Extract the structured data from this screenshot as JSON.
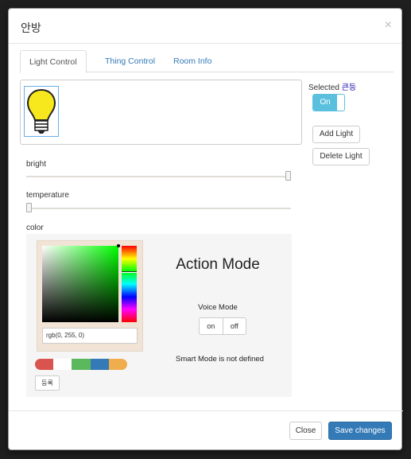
{
  "modal": {
    "title": "안방",
    "close_glyph": "×"
  },
  "tabs": [
    {
      "label": "Light Control",
      "active": true
    },
    {
      "label": "Thing Control",
      "active": false
    },
    {
      "label": "Room Info",
      "active": false
    }
  ],
  "light_panel": {
    "bulb_icon": "lightbulb-icon",
    "bulb_color": "#f7e81e"
  },
  "side_panel": {
    "selected_label": "Selected",
    "selected_name": "큰등",
    "toggle_label": "On",
    "toggle_state": true,
    "add_light_label": "Add Light",
    "delete_light_label": "Delete Light"
  },
  "sliders": {
    "bright_label": "bright",
    "bright_value": 1.0,
    "temperature_label": "temperature",
    "temperature_value": 0.0
  },
  "color": {
    "label": "color",
    "rgb_text": "rgb(0, 255, 0)",
    "current": "#00ff00",
    "swatches": [
      "#d9534f",
      "#ffffff",
      "#5cb85c",
      "#337ab7",
      "#f0ad4e"
    ],
    "register_label": "등록"
  },
  "action": {
    "title": "Action Mode",
    "voice_label": "Voice Mode",
    "voice_on": "on",
    "voice_off": "off",
    "smart_text": "Smart Mode is not defined"
  },
  "footer": {
    "close_label": "Close",
    "save_label": "Save changes"
  }
}
